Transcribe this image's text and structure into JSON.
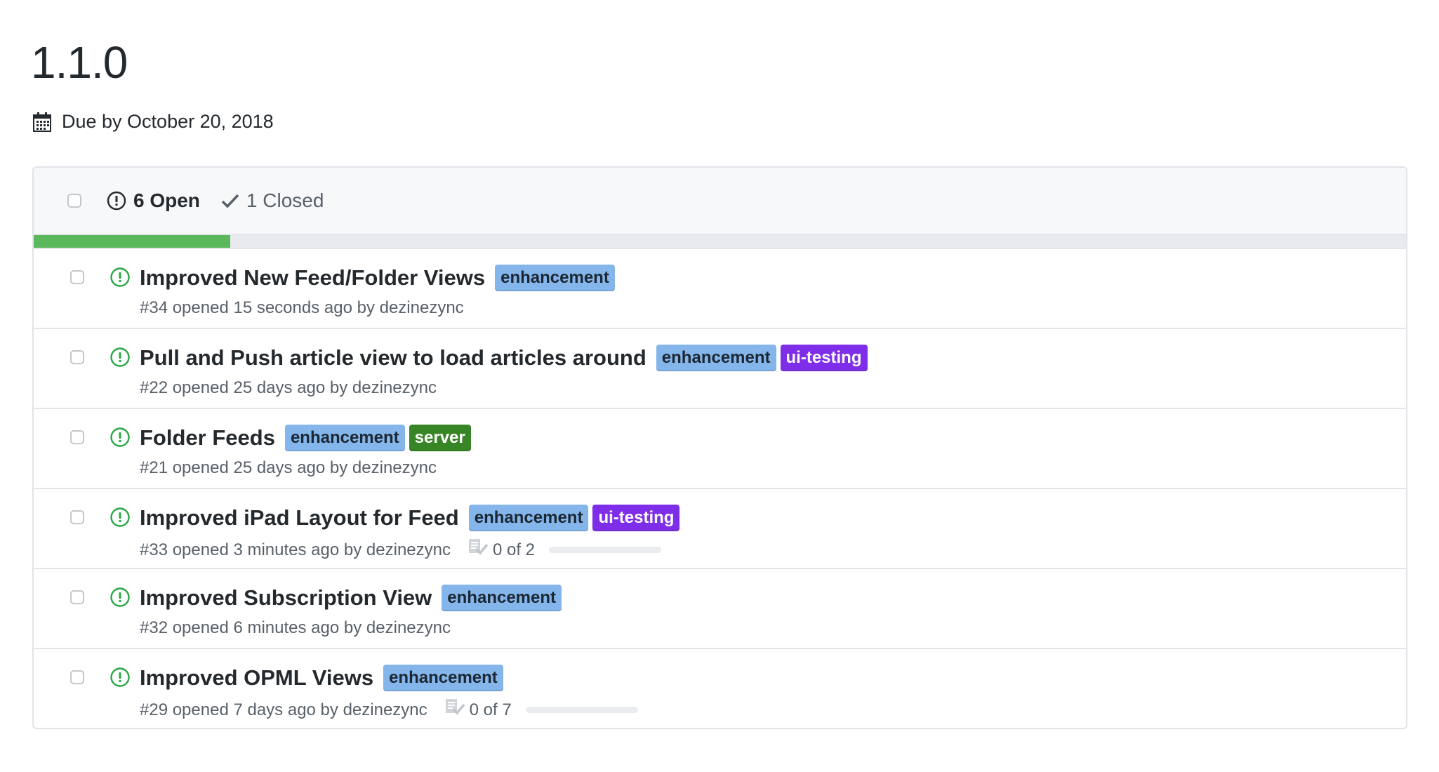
{
  "milestone": {
    "title": "1.1.0",
    "due": "Due by October 20, 2018",
    "due_icon": "calendar-icon"
  },
  "states": {
    "open_label": "6 Open",
    "open_icon": "issue-opened-icon",
    "closed_label": "1 Closed",
    "closed_icon": "check-icon"
  },
  "progress": {
    "percent_complete": 14.3
  },
  "colors": {
    "progress": "#5cb85c",
    "open_icon": "#28a745",
    "labels": {
      "enhancement": {
        "bg": "#84b6eb",
        "fg": "#1c2733"
      },
      "ui-testing": {
        "bg": "#7e2de8",
        "fg": "#ffffff"
      },
      "server": {
        "bg": "#378524",
        "fg": "#ffffff"
      }
    }
  },
  "issues": [
    {
      "title": "Improved New Feed/Folder Views",
      "labels": [
        "enhancement"
      ],
      "meta": "#34 opened 15 seconds ago by dezinezync",
      "tasks": null
    },
    {
      "title": "Pull and Push article view to load articles around",
      "labels": [
        "enhancement",
        "ui-testing"
      ],
      "meta": "#22 opened 25 days ago by dezinezync",
      "tasks": null
    },
    {
      "title": "Folder Feeds",
      "labels": [
        "enhancement",
        "server"
      ],
      "meta": "#21 opened 25 days ago by dezinezync",
      "tasks": null
    },
    {
      "title": "Improved iPad Layout for Feed",
      "labels": [
        "enhancement",
        "ui-testing"
      ],
      "meta": "#33 opened 3 minutes ago by dezinezync",
      "tasks": {
        "text": "0 of 2",
        "done": 0,
        "total": 2
      }
    },
    {
      "title": "Improved Subscription View",
      "labels": [
        "enhancement"
      ],
      "meta": "#32 opened 6 minutes ago by dezinezync",
      "tasks": null
    },
    {
      "title": "Improved OPML Views",
      "labels": [
        "enhancement"
      ],
      "meta": "#29 opened 7 days ago by dezinezync",
      "tasks": {
        "text": "0 of 7",
        "done": 0,
        "total": 7
      }
    }
  ]
}
